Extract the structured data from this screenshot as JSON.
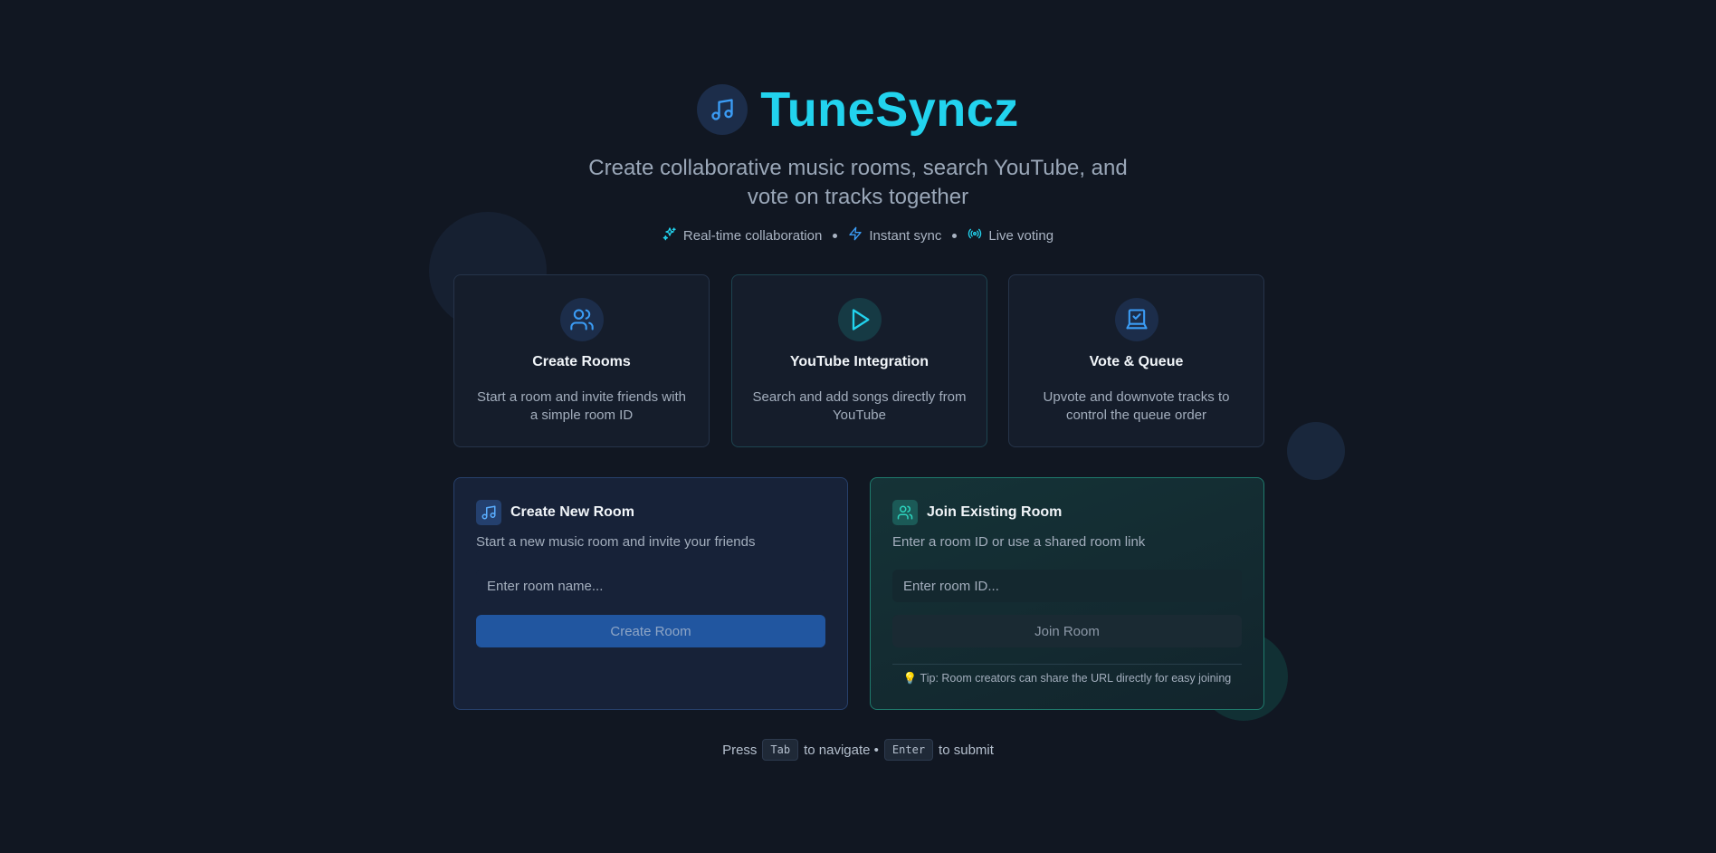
{
  "app": {
    "title": "TuneSyncz",
    "logo_icon": "music-note-icon"
  },
  "subtitle": "Create collaborative music rooms, search YouTube, and vote on tracks together",
  "highlights": [
    {
      "icon": "sparkles-icon",
      "label": "Real-time collaboration"
    },
    {
      "icon": "lightning-icon",
      "label": "Instant sync"
    },
    {
      "icon": "broadcast-icon",
      "label": "Live voting"
    }
  ],
  "features": [
    {
      "icon": "users-icon",
      "title": "Create Rooms",
      "description": "Start a room and invite friends with a simple room ID"
    },
    {
      "icon": "play-icon",
      "title": "YouTube Integration",
      "description": "Search and add songs directly from YouTube"
    },
    {
      "icon": "vote-icon",
      "title": "Vote & Queue",
      "description": "Upvote and downvote tracks to control the queue order"
    }
  ],
  "create_room": {
    "title": "Create New Room",
    "subtitle": "Start a new music room and invite your friends",
    "input_placeholder": "Enter room name...",
    "button_label": "Create Room"
  },
  "join_room": {
    "title": "Join Existing Room",
    "subtitle": "Enter a room ID or use a shared room link",
    "input_placeholder": "Enter room ID...",
    "button_label": "Join Room",
    "tip": "💡 Tip: Room creators can share the URL directly for easy joining"
  },
  "footer": {
    "press": "Press",
    "tab_key": "Tab",
    "to_navigate": "to navigate •",
    "enter_key": "Enter",
    "to_submit": "to submit"
  },
  "colors": {
    "accent": "#22d3ee",
    "background": "#111722",
    "primary_button": "#2156a0",
    "join_border": "#1f7a6c"
  }
}
